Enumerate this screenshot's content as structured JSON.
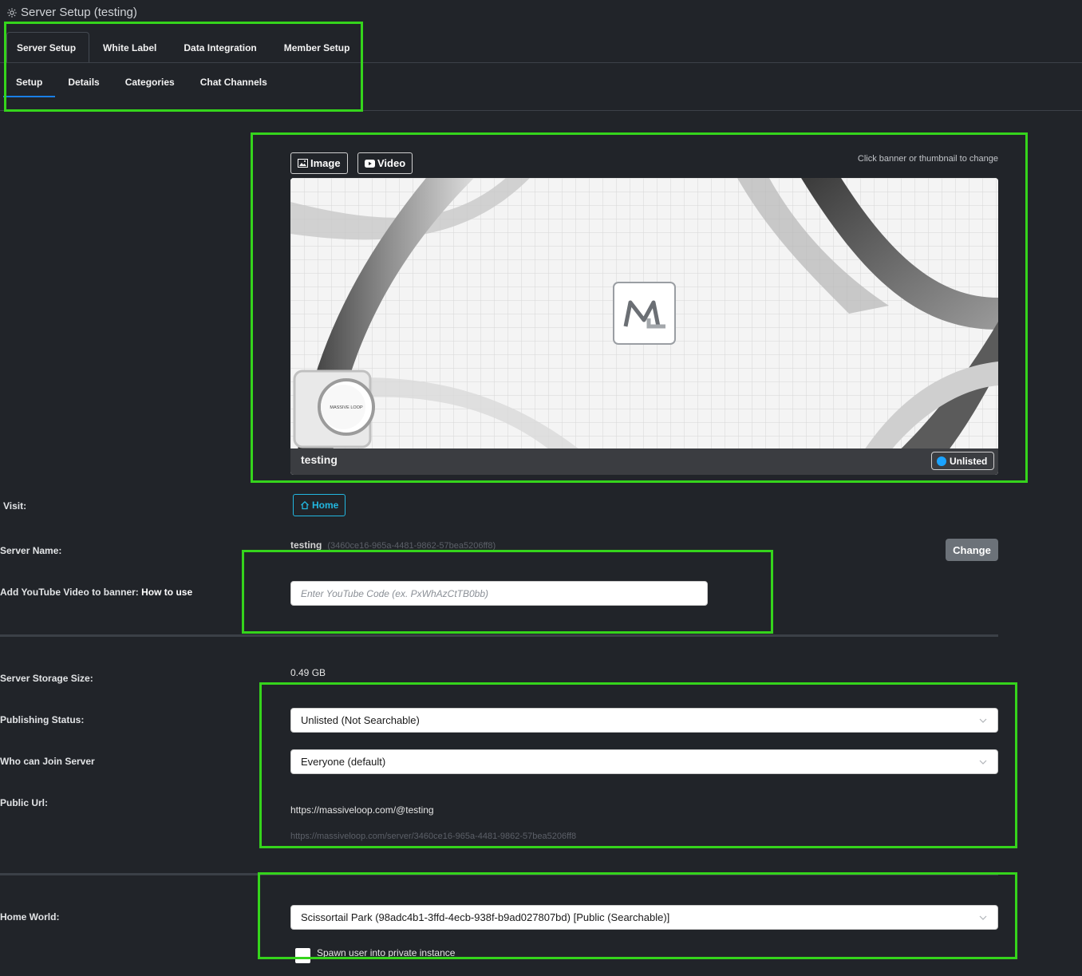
{
  "header": {
    "title": "Server Setup (testing)"
  },
  "tabs": [
    "Server Setup",
    "White Label",
    "Data Integration",
    "Member Setup"
  ],
  "subtabs": [
    "Setup",
    "Details",
    "Categories",
    "Chat Channels"
  ],
  "banner": {
    "image_button": "Image",
    "video_button": "Video",
    "hint": "Click banner or thumbnail to change",
    "server_caption": "testing",
    "status_badge": "Unlisted",
    "logo_text": "MASSIVE LOOP"
  },
  "visit": {
    "label": "Visit:",
    "home_button": "Home"
  },
  "server_name": {
    "label": "Server Name:",
    "value": "testing",
    "id": "(3460ce16-965a-4481-9862-57bea5206ff8)",
    "change_button": "Change"
  },
  "youtube": {
    "label": "Add YouTube Video to banner:",
    "link": "How to use",
    "placeholder": "Enter YouTube Code (ex. PxWhAzCtTB0bb)"
  },
  "storage": {
    "label": "Server Storage Size:",
    "value": "0.49 GB"
  },
  "publishing": {
    "label": "Publishing Status:",
    "value": "Unlisted (Not Searchable)"
  },
  "join": {
    "label": "Who can Join Server",
    "value": "Everyone (default)"
  },
  "public_url": {
    "label": "Public Url:",
    "value": "https://massiveloop.com/@testing",
    "alt": "https://massiveloop.com/server/3460ce16-965a-4481-9862-57bea5206ff8"
  },
  "home_world": {
    "label": "Home World:",
    "value": "Scissortail Park (98adc4b1-3ffd-4ecb-938f-b9ad027807bd) [Public (Searchable)]",
    "spawn_label": "Spawn user into private instance"
  },
  "colors": {
    "accent": "#1a7fe6",
    "highlight": "#35d41c",
    "link": "#22b7e0",
    "badge_dot": "#1aa3ff"
  }
}
